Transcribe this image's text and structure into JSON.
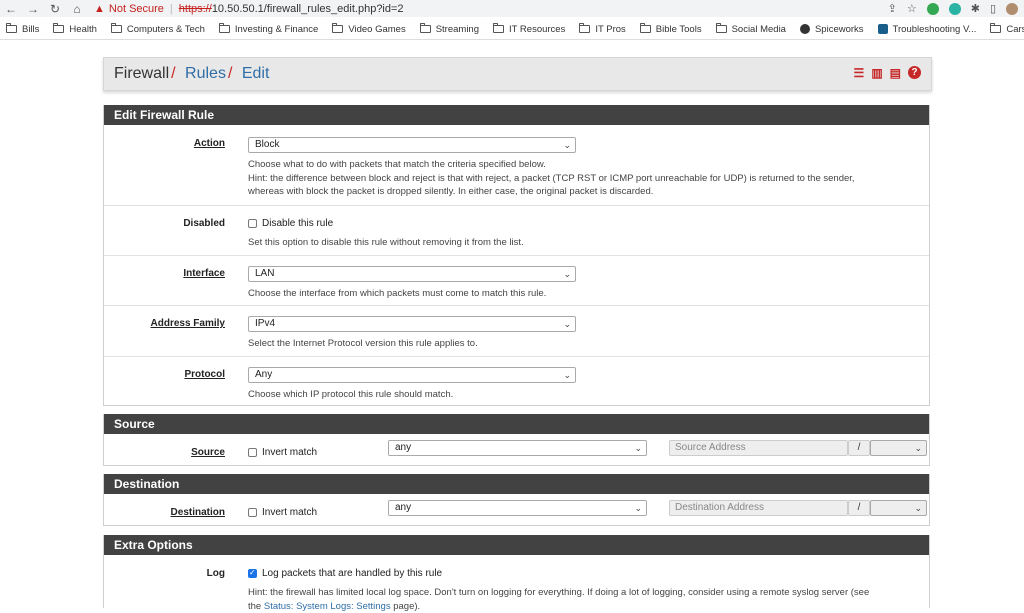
{
  "browser": {
    "not_secure": "Not Secure",
    "url_scheme": "https://",
    "url_rest": "10.50.50.1/firewall_rules_edit.php?id=2"
  },
  "bookmarks": [
    "Bills",
    "Health",
    "Computers & Tech",
    "Investing & Finance",
    "Video Games",
    "Streaming",
    "IT Resources",
    "IT Pros",
    "Bible Tools",
    "Social Media",
    "Spiceworks",
    "Troubleshooting V...",
    "Cars"
  ],
  "breadcrumb": {
    "root": "Firewall",
    "rules": "Rules",
    "edit": "Edit"
  },
  "edit_rule": {
    "title": "Edit Firewall Rule",
    "action": {
      "label": "Action",
      "value": "Block",
      "help1": "Choose what to do with packets that match the criteria specified below.",
      "help2": "Hint: the difference between block and reject is that with reject, a packet (TCP RST or ICMP port unreachable for UDP) is returned to the sender,",
      "help3": "whereas with block the packet is dropped silently. In either case, the original packet is discarded."
    },
    "disabled": {
      "label": "Disabled",
      "checkbox_label": "Disable this rule",
      "help": "Set this option to disable this rule without removing it from the list."
    },
    "interface": {
      "label": "Interface",
      "value": "LAN",
      "help": "Choose the interface from which packets must come to match this rule."
    },
    "address_family": {
      "label": "Address Family",
      "value": "IPv4",
      "help": "Select the Internet Protocol version this rule applies to."
    },
    "protocol": {
      "label": "Protocol",
      "value": "Any",
      "help": "Choose which IP protocol this rule should match."
    }
  },
  "source": {
    "title": "Source",
    "label": "Source",
    "invert": "Invert match",
    "type": "any",
    "address_placeholder": "Source Address",
    "slash": "/"
  },
  "destination": {
    "title": "Destination",
    "label": "Destination",
    "invert": "Invert match",
    "type": "any",
    "address_placeholder": "Destination Address",
    "slash": "/"
  },
  "extra": {
    "title": "Extra Options",
    "log_label": "Log",
    "log_checkbox": "Log packets that are handled by this rule",
    "log_hint": "Hint: the firewall has limited local log space. Don't turn on logging for everything. If doing a lot of logging, consider using a remote syslog server (see",
    "log_hint2_pre": "the ",
    "log_hint_link": "Status: System Logs: Settings",
    "log_hint2_post": " page)."
  }
}
